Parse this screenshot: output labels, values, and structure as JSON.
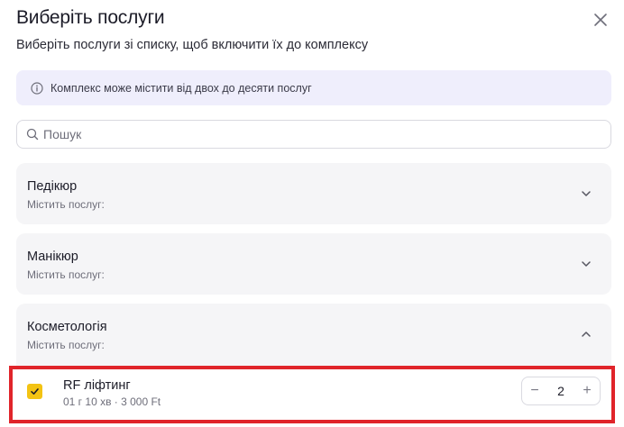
{
  "modal": {
    "title": "Виберіть послуги",
    "subtitle": "Виберіть послуги зі списку, щоб включити їх до комплексу",
    "info": "Комплекс може містити від двох до десяти послуг",
    "search_placeholder": "Пошук"
  },
  "categories": [
    {
      "name": "Педікюр",
      "sub": "Містить послуг:",
      "state": "collapsed"
    },
    {
      "name": "Манікюр",
      "sub": "Містить послуг:",
      "state": "collapsed"
    },
    {
      "name": "Косметологія",
      "sub": "Містить послуг:",
      "state": "expanded"
    }
  ],
  "services": [
    {
      "name": "RF ліфтинг",
      "details": "01 г 10 хв · 3 000 Ft",
      "checked": true,
      "quantity": "2",
      "minus": "−",
      "plus": "+"
    }
  ],
  "colors": {
    "accent_check": "#f3c313",
    "info_bg": "#efeefc",
    "highlight": "#e0242a",
    "card_bg": "#f5f5f7"
  }
}
